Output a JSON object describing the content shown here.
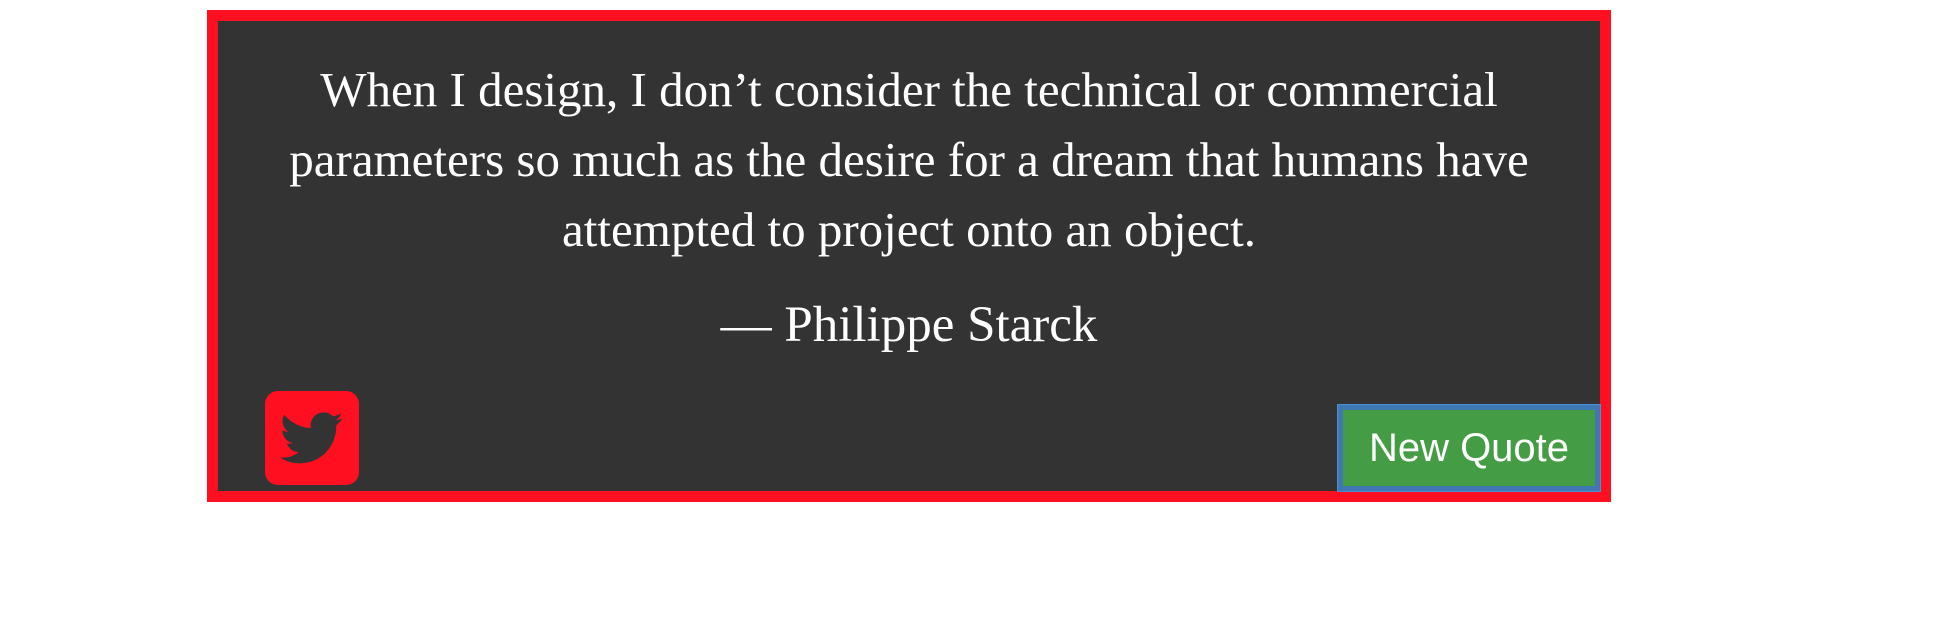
{
  "quote": {
    "text": "When I design, I don’t consider the technical or commercial parameters so much as the desire for a dream that humans have attempted to project onto an object.",
    "author": "— Philippe Starck"
  },
  "actions": {
    "tweet_icon": "twitter-icon",
    "new_quote_label": "New Quote"
  },
  "colors": {
    "page_background": "#ffffff",
    "box_background": "#333333",
    "box_border": "#ff0f1f",
    "text": "#ffffff",
    "tweet_button": "#ff0f1f",
    "tweet_bird": "#333333",
    "new_quote_background": "#449d44",
    "new_quote_focus_ring": "#3f77b2"
  }
}
